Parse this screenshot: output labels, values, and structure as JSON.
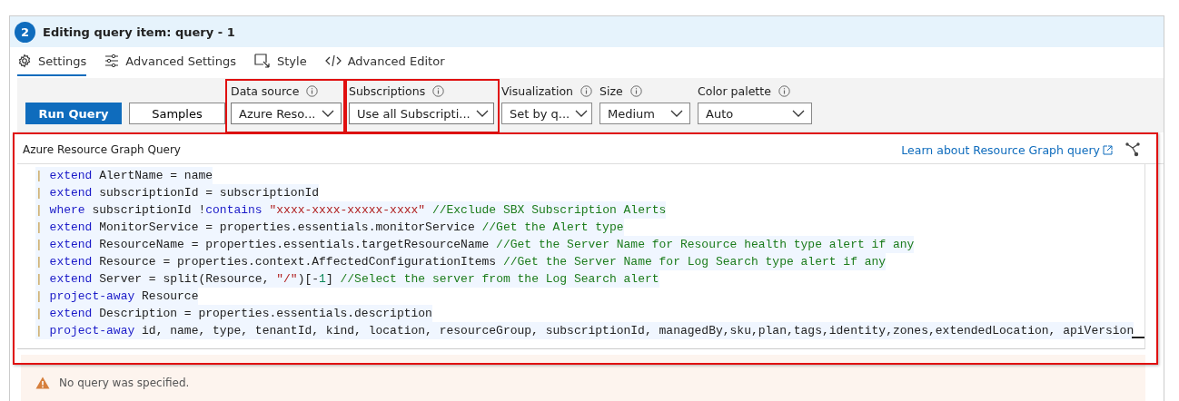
{
  "header": {
    "step": "2",
    "title": "Editing query item: query - 1"
  },
  "tabs": [
    {
      "label": "Settings",
      "selected": true
    },
    {
      "label": "Advanced Settings",
      "selected": false
    },
    {
      "label": "Style",
      "selected": false
    },
    {
      "label": "Advanced Editor",
      "selected": false
    }
  ],
  "toolbar": {
    "buttons": [
      {
        "label": "Run Query",
        "kind": "primary"
      },
      {
        "label": "Samples",
        "kind": "default"
      }
    ],
    "fields": [
      {
        "label": "Data source",
        "value": "Azure Reso...",
        "highlighted": true
      },
      {
        "label": "Subscriptions",
        "value": "Use all Subscripti...",
        "highlighted": true
      },
      {
        "label": "Visualization",
        "value": "Set by q...",
        "highlighted": false
      },
      {
        "label": "Size",
        "value": "Medium",
        "highlighted": false
      },
      {
        "label": "Color palette",
        "value": "Auto",
        "highlighted": false
      }
    ]
  },
  "editor": {
    "title": "Azure Resource Graph Query",
    "link": "Learn about Resource Graph query",
    "highlighted": true,
    "lines": [
      [
        {
          "kind": "pipe",
          "text": "|"
        },
        {
          "kind": "kw",
          "text": " extend"
        },
        {
          "kind": "plain",
          "text": " AlertName = name"
        }
      ],
      [
        {
          "kind": "pipe",
          "text": "|"
        },
        {
          "kind": "kw",
          "text": " extend"
        },
        {
          "kind": "plain",
          "text": " subscriptionId = subscriptionId"
        }
      ],
      [
        {
          "kind": "pipe",
          "text": "|"
        },
        {
          "kind": "kw",
          "text": " where"
        },
        {
          "kind": "plain",
          "text": " subscriptionId !"
        },
        {
          "kind": "kw",
          "text": "contains"
        },
        {
          "kind": "str",
          "text": " \"xxxx-xxxx-xxxxx-xxxx\""
        },
        {
          "kind": "comment",
          "text": " //Exclude SBX Subscription Alerts"
        }
      ],
      [
        {
          "kind": "pipe",
          "text": "|"
        },
        {
          "kind": "kw",
          "text": " extend"
        },
        {
          "kind": "plain",
          "text": " MonitorService = properties.essentials.monitorService "
        },
        {
          "kind": "comment",
          "text": "//Get the Alert type"
        }
      ],
      [
        {
          "kind": "pipe",
          "text": "|"
        },
        {
          "kind": "kw",
          "text": " extend"
        },
        {
          "kind": "plain",
          "text": " ResourceName = properties.essentials.targetResourceName "
        },
        {
          "kind": "comment",
          "text": "//Get the Server Name for Resource health type alert if any"
        }
      ],
      [
        {
          "kind": "pipe",
          "text": "|"
        },
        {
          "kind": "kw",
          "text": " extend"
        },
        {
          "kind": "plain",
          "text": " Resource = properties.context.AffectedConfigurationItems "
        },
        {
          "kind": "comment",
          "text": "//Get the Server Name for Log Search type alert if any"
        }
      ],
      [
        {
          "kind": "pipe",
          "text": "|"
        },
        {
          "kind": "kw",
          "text": " extend"
        },
        {
          "kind": "plain",
          "text": " Server = split(Resource, "
        },
        {
          "kind": "str",
          "text": "\"/\""
        },
        {
          "kind": "plain",
          "text": ")[-"
        },
        {
          "kind": "num",
          "text": "1"
        },
        {
          "kind": "plain",
          "text": "] "
        },
        {
          "kind": "comment",
          "text": "//Select the server from the Log Search alert"
        }
      ],
      [
        {
          "kind": "pipe",
          "text": "|"
        },
        {
          "kind": "kw",
          "text": " project-away"
        },
        {
          "kind": "plain",
          "text": " Resource"
        }
      ],
      [
        {
          "kind": "pipe",
          "text": "|"
        },
        {
          "kind": "kw",
          "text": " extend"
        },
        {
          "kind": "plain",
          "text": " Description = properties.essentials.description"
        }
      ],
      [
        {
          "kind": "pipe",
          "text": "|"
        },
        {
          "kind": "kw",
          "text": " project-away"
        },
        {
          "kind": "plain",
          "text": " id, name, type, tenantId, kind, location, resourceGroup, subscriptionId, managedBy,sku,plan,tags,identity,zones,extendedLocation, apiVersion"
        }
      ]
    ]
  },
  "warning": {
    "message": "No query was specified."
  }
}
